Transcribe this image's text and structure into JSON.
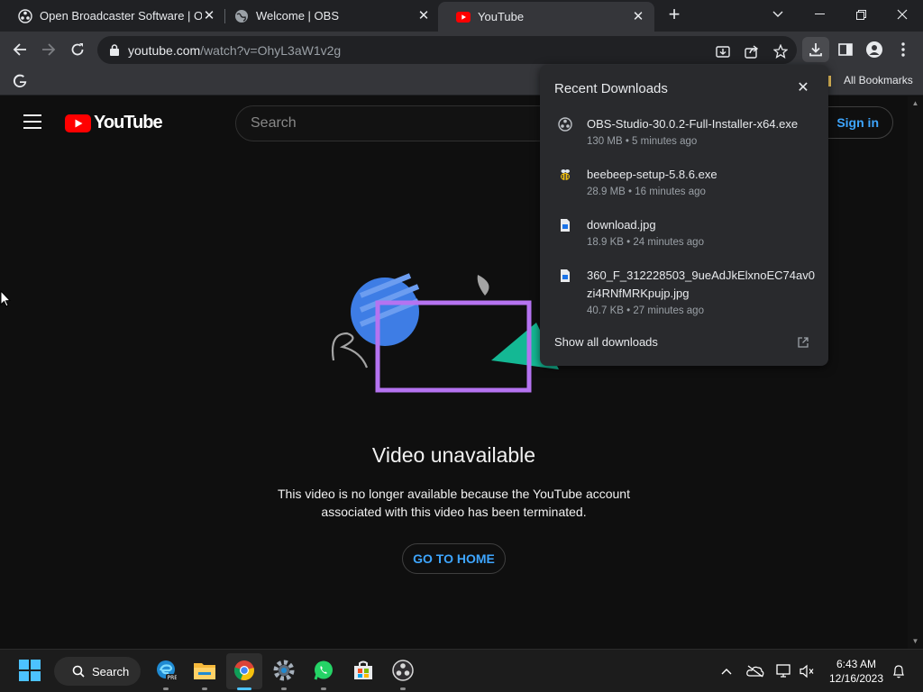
{
  "tabs": [
    {
      "title": "Open Broadcaster Software | OBS",
      "favicon": "obs-icon"
    },
    {
      "title": "Welcome | OBS",
      "favicon": "globe-icon"
    },
    {
      "title": "YouTube",
      "favicon": "youtube-icon",
      "active": true
    }
  ],
  "omnibox": {
    "host": "youtube.com",
    "path": "/watch?v=OhyL3aW1v2g"
  },
  "bookmarks": {
    "item_label": "",
    "all_label": "All Bookmarks"
  },
  "youtube": {
    "logo_text": "YouTube",
    "search_placeholder": "Search",
    "signin_label": "Sign in",
    "unavailable_title": "Video unavailable",
    "unavailable_line1": "This video is no longer available because the YouTube account",
    "unavailable_line2": "associated with this video has been terminated.",
    "home_button": "GO TO HOME"
  },
  "downloads": {
    "title": "Recent Downloads",
    "items": [
      {
        "name": "OBS-Studio-30.0.2-Full-Installer-x64.exe",
        "meta": "130 MB • 5 minutes ago",
        "icon": "obs-icon"
      },
      {
        "name": "beebeep-setup-5.8.6.exe",
        "meta": "28.9 MB • 16 minutes ago",
        "icon": "bee-icon"
      },
      {
        "name": "download.jpg",
        "meta": "18.9 KB • 24 minutes ago",
        "icon": "image-file-icon"
      },
      {
        "name": "360_F_312228503_9ueAdJkElxnoEC74av0zi4RNfMRKpujp.jpg",
        "meta": "40.7 KB • 27 minutes ago",
        "icon": "image-file-icon"
      }
    ],
    "show_all": "Show all downloads"
  },
  "taskbar": {
    "search_label": "Search",
    "time": "6:43 AM",
    "date": "12/16/2023"
  },
  "colors": {
    "accent_blue": "#3ea6ff",
    "youtube_red": "#ff0000",
    "chrome_dark": "#202124",
    "taskbar_active": "#4cc2ff"
  }
}
